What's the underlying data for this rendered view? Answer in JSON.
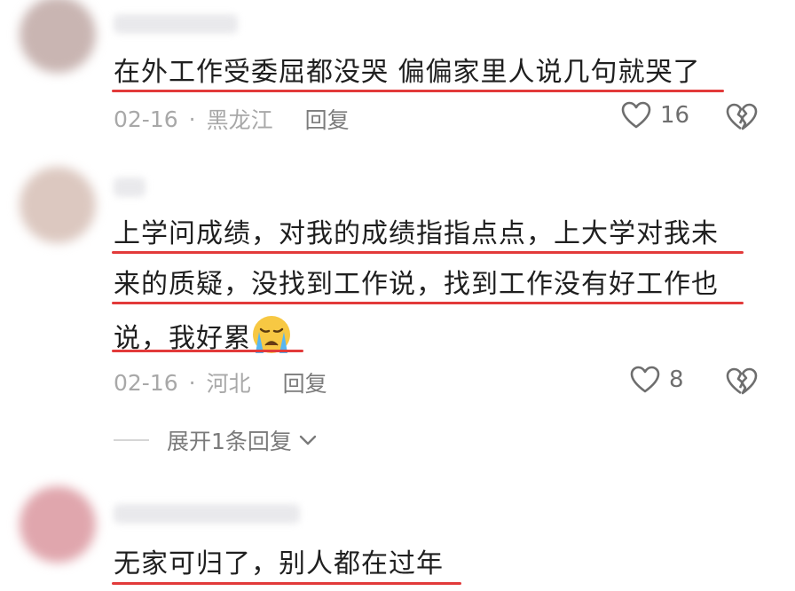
{
  "comments": [
    {
      "text": "在外工作受委屈都没哭 偏偏家里人说几句就哭了",
      "date": "02-16",
      "separator": "·",
      "region": "黑龙江",
      "reply_label": "回复",
      "likes": "16",
      "avatar_color": "#c9b5b2"
    },
    {
      "lines": [
        "上学问成绩，对我的成绩指指点点，上大学对我未",
        "来的质疑，没找到工作说，找到工作没有好工作也",
        "说，我好累"
      ],
      "emoji": "crying-face-icon",
      "date": "02-16",
      "separator": "·",
      "region": "河北",
      "reply_label": "回复",
      "likes": "8",
      "avatar_color": "#dcc8c0"
    },
    {
      "text": "无家可归了，别人都在过年",
      "avatar_color": "#e0a6ad"
    }
  ],
  "expand_replies": {
    "label": "展开1条回复"
  },
  "colors": {
    "underline": "#e23a3a",
    "meta": "#a8a8a8",
    "icon": "#6e6e6e"
  }
}
